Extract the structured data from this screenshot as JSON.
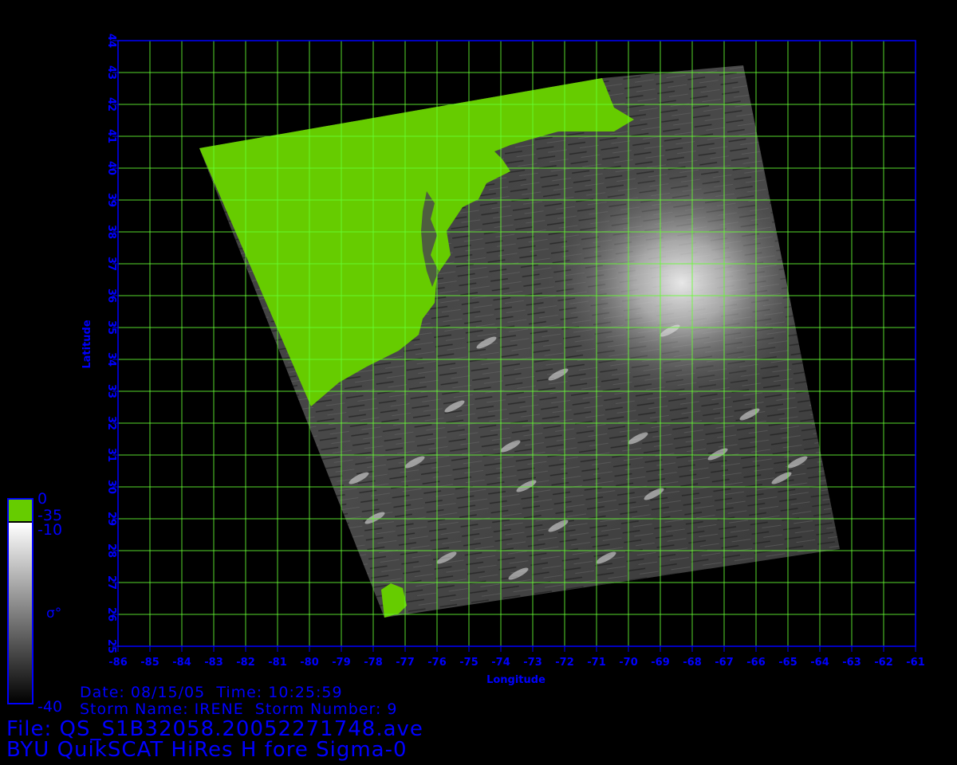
{
  "map": {
    "x_axis_label": "Longitude",
    "y_axis_label": "Latitude",
    "lon_ticks": [
      "-86",
      "-85",
      "-84",
      "-83",
      "-82",
      "-81",
      "-80",
      "-79",
      "-78",
      "-77",
      "-76",
      "-75",
      "-74",
      "-73",
      "-72",
      "-71",
      "-70",
      "-69",
      "-68",
      "-67",
      "-66",
      "-65",
      "-64",
      "-63",
      "-62",
      "-61"
    ],
    "lat_ticks": [
      "25",
      "26",
      "27",
      "28",
      "29",
      "30",
      "31",
      "32",
      "33",
      "34",
      "35",
      "36",
      "37",
      "38",
      "39",
      "40",
      "41",
      "42",
      "43",
      "44"
    ],
    "lon_range": [
      -86,
      -61
    ],
    "lat_range": [
      25,
      44
    ],
    "land_color": "#66cc00",
    "grid_color": "#66ff33",
    "frame_color": "#0000ff",
    "storm_center": {
      "lon": -68,
      "lat": 36
    }
  },
  "colorbar": {
    "land_max": "0",
    "land_min": "-35",
    "scale_max": "-10",
    "scale_min": "-40",
    "symbol": "σ°"
  },
  "info": {
    "date_label": "Date:",
    "date_value": "08/15/05",
    "time_label": "Time:",
    "time_value": "10:25:59",
    "storm_name_label": "Storm Name:",
    "storm_name_value": "IRENE",
    "storm_number_label": "Storm Number:",
    "storm_number_value": "9",
    "file_label": "File:",
    "file_value": "QS_S1B32058.20052271748.ave",
    "product_title": "BYU QuikSCAT HiRes H fore Sigma-0"
  }
}
